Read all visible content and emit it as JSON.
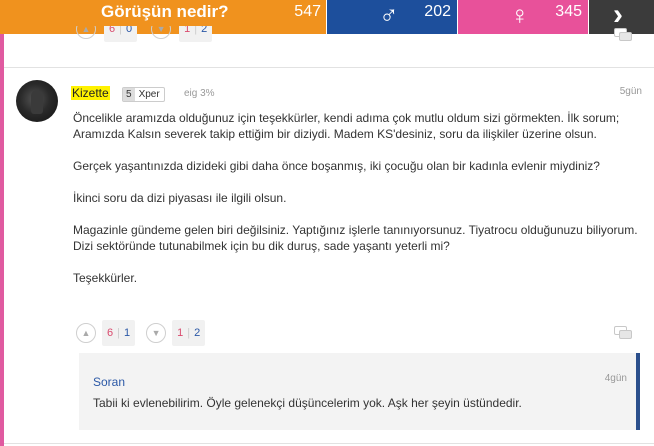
{
  "topbar": {
    "question_title": "Görüşün nedir?",
    "total_count": "547",
    "male_count": "202",
    "female_count": "345",
    "male_icon": "male-symbol-icon",
    "female_icon": "female-symbol-icon",
    "next_icon": "chevron-right-icon"
  },
  "colors": {
    "question_bg": "#f0921e",
    "male_bg": "#1d4f9c",
    "female_bg": "#e8519a",
    "next_bg": "#3b3b3b",
    "upvote_count": "#d94b6e",
    "downvote_count": "#2b58a6",
    "highlight": "#fff200"
  },
  "previous_comment": {
    "up_a": "6",
    "up_b": "0",
    "down_a": "1",
    "down_b": "2"
  },
  "comment": {
    "username": "Kizette",
    "level": "5",
    "rank": "Xper",
    "eig": "eig 3%",
    "time": "5gün",
    "paragraphs": [
      "Öncelikle aramızda olduğunuz için teşekkürler, kendi adıma çok mutlu oldum sizi görmekten. İlk sorum; Aramızda Kalsın severek takip ettiğim bir diziydi. Madem KS'desiniz, soru da ilişkiler üzerine olsun.",
      "Gerçek yaşantınızda dizideki gibi daha önce boşanmış, iki çocuğu olan bir kadınla evlenir miydiniz?",
      "İkinci soru da dizi piyasası ile ilgili olsun.",
      "Magazinle gündeme gelen biri değilsiniz. Yaptığınız işlerle tanınıyorsunuz. Tiyatrocu olduğunuzu biliyorum. Dizi sektöründe tutunabilmek için bu dik duruş, sade yaşantı yeterli mi?",
      "Teşekkürler."
    ],
    "votes": {
      "up_a": "6",
      "up_b": "1",
      "down_a": "1",
      "down_b": "2"
    }
  },
  "reply": {
    "author": "Soran",
    "time": "4gün",
    "text": "Tabii ki evlenebilirim. Öyle gelenekçi düşüncelerim yok. Aşk her şeyin üstündedir."
  }
}
